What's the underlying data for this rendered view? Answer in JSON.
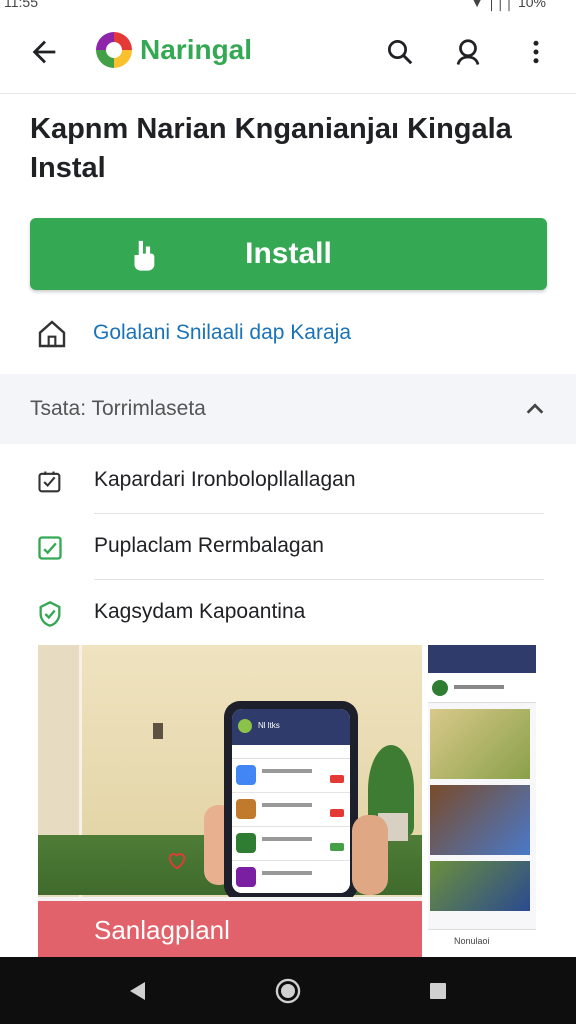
{
  "status_bar": {
    "time": "11:55",
    "icons_text": "▼ │││ 10%"
  },
  "app_bar": {
    "brand": "Naringal",
    "icons": [
      "back-arrow-icon",
      "brand-logo",
      "search-icon",
      "account-icon",
      "more-vert-icon"
    ]
  },
  "app": {
    "title": "Kapnm Narian Knganianjaı Kingala Instal"
  },
  "install_button": {
    "label": "Install",
    "icon": "touch-hand-icon",
    "color": "#34a853"
  },
  "home_link": {
    "label": "Golalani Snilaali dap Karaja",
    "icon": "home-icon"
  },
  "section": {
    "label": "Tsata: Torrimlaseta",
    "expanded": true
  },
  "permissions": [
    {
      "label": "Kapardari Ironbolopllallagan",
      "icon": "checklist-icon"
    },
    {
      "label": "Puplaclam Rermbalagan",
      "icon": "checkbox-icon"
    },
    {
      "label": "Kagsydam Kapoantina",
      "icon": "verified-shield-icon"
    }
  ],
  "screenshots": {
    "main_banner": "Sanlagplanl",
    "phone_header": "Nl ltks",
    "side_title": "Nonulaoi"
  },
  "nav_bar": {
    "buttons": [
      "back-triangle-icon",
      "home-circle-icon",
      "recents-square-icon"
    ]
  },
  "colors": {
    "accent": "#34a853",
    "link": "#1a73b8",
    "section_bg": "#f4f5f8",
    "banner": "#e1626b"
  }
}
